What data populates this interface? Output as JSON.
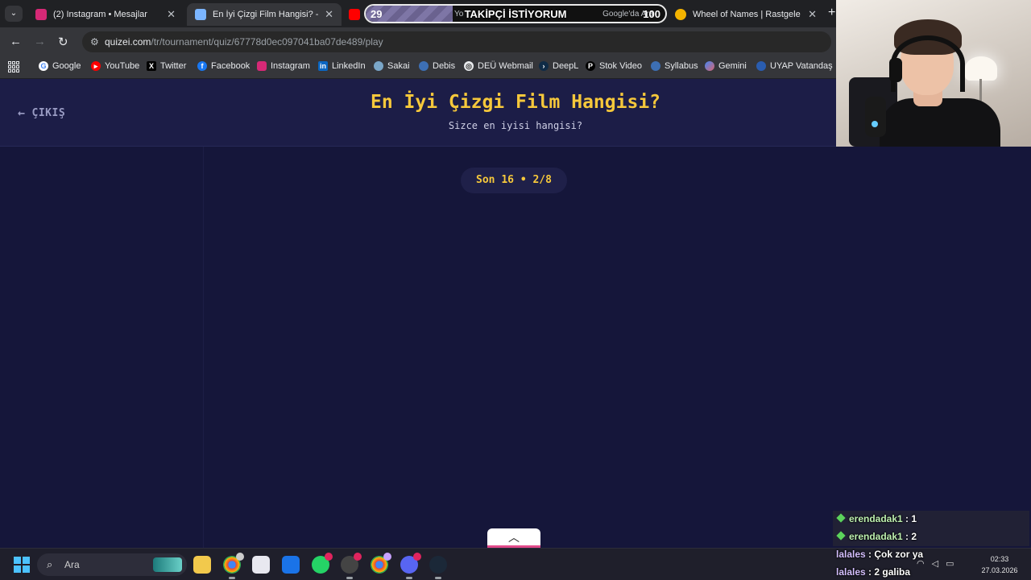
{
  "browser": {
    "tabs": [
      {
        "label": "(2) Instagram • Mesajlar",
        "color": "#d62976"
      },
      {
        "label": "En İyi Çizgi Film Hangisi? - Tier",
        "color": "#7bb5ff"
      },
      {
        "label": "Yo",
        "color": "#ff0000"
      },
      {
        "label": "Google'da Ara",
        "color": "#4285f4"
      },
      {
        "label": "Wheel of Names | Rastgele ad s",
        "color": "#f4b400"
      }
    ],
    "url_host": "quizei.com",
    "url_path": "/tr/tournament/quiz/67778d0ec097041ba07de489/play",
    "bookmarks": [
      "Google",
      "YouTube",
      "Twitter",
      "Facebook",
      "Instagram",
      "LinkedIn",
      "Sakai",
      "Debis",
      "DEÜ Webmail",
      "DeepL",
      "Stok Video",
      "Syllabus",
      "Gemini",
      "UYAP Vatandaş"
    ]
  },
  "stream_overlay": {
    "title": "TAKİPÇİ İSTİYORUM",
    "current": "29",
    "goal": "100",
    "progress": 0.29
  },
  "page": {
    "exit_label": "ÇIKIŞ",
    "title": "En İyi Çizgi Film Hangisi?",
    "subtitle": "Sizce en iyisi hangisi?",
    "round": "Son 16 • 2/8"
  },
  "taskbar": {
    "search_placeholder": "Ara",
    "time": "02:33",
    "date": "27.03.2026"
  },
  "chat": [
    {
      "user": "erendadak1",
      "text": ": 1"
    },
    {
      "user": "erendadak1",
      "text": ": 2"
    },
    {
      "user": "lalales",
      "text": ": Çok zor ya"
    },
    {
      "user": "lalales",
      "text": ": 2 galiba"
    }
  ]
}
